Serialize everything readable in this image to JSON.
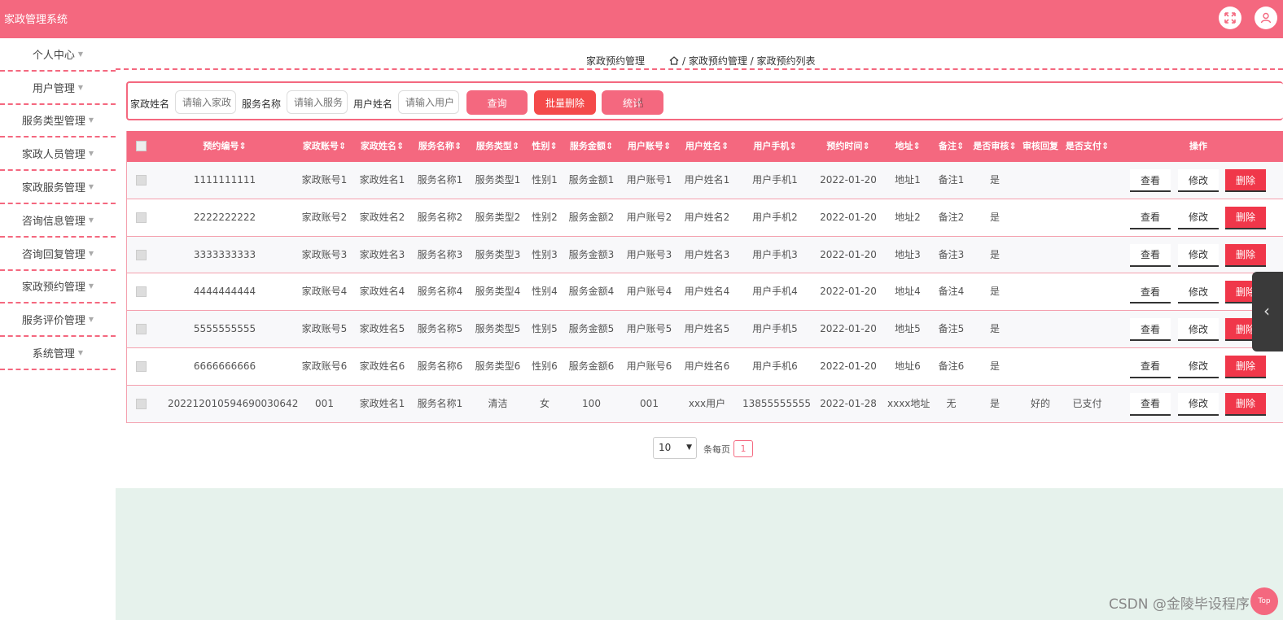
{
  "app": {
    "title": "家政管理系统"
  },
  "header": {
    "fullscreen_icon": "expand-icon",
    "user_icon": "user-icon"
  },
  "sidebar": {
    "items": [
      {
        "label": "个人中心"
      },
      {
        "label": "用户管理"
      },
      {
        "label": "服务类型管理"
      },
      {
        "label": "家政人员管理"
      },
      {
        "label": "家政服务管理"
      },
      {
        "label": "咨询信息管理"
      },
      {
        "label": "咨询回复管理"
      },
      {
        "label": "家政预约管理"
      },
      {
        "label": "服务评价管理"
      },
      {
        "label": "系统管理"
      }
    ]
  },
  "breadcrumb": {
    "title": "家政预约管理",
    "path": "/ 家政预约管理 / 家政预约列表"
  },
  "search": {
    "label_1": "家政姓名",
    "placeholder_1": "请输入家政",
    "label_2": "服务名称",
    "placeholder_2": "请输入服务",
    "label_3": "用户姓名",
    "placeholder_3": "请输入用户",
    "query_label": "查询",
    "batch_delete_label": "批量删除",
    "stats_label": "统计"
  },
  "colors": {
    "primary": "#f4687f",
    "danger": "#f0374a",
    "batch": "#f44a4a",
    "footer_bg": "#e6f2ec"
  },
  "table": {
    "headers": [
      "预约编号",
      "家政账号",
      "家政姓名",
      "服务名称",
      "服务类型",
      "性别",
      "服务金额",
      "用户账号",
      "用户姓名",
      "用户手机",
      "预约时间",
      "地址",
      "备注",
      "是否审核",
      "审核回复",
      "是否支付",
      "操作"
    ],
    "rows": [
      [
        "1111111111",
        "家政账号1",
        "家政姓名1",
        "服务名称1",
        "服务类型1",
        "性别1",
        "服务金额1",
        "用户账号1",
        "用户姓名1",
        "用户手机1",
        "2022-01-20",
        "地址1",
        "备注1",
        "是",
        "",
        ""
      ],
      [
        "2222222222",
        "家政账号2",
        "家政姓名2",
        "服务名称2",
        "服务类型2",
        "性别2",
        "服务金额2",
        "用户账号2",
        "用户姓名2",
        "用户手机2",
        "2022-01-20",
        "地址2",
        "备注2",
        "是",
        "",
        ""
      ],
      [
        "3333333333",
        "家政账号3",
        "家政姓名3",
        "服务名称3",
        "服务类型3",
        "性别3",
        "服务金额3",
        "用户账号3",
        "用户姓名3",
        "用户手机3",
        "2022-01-20",
        "地址3",
        "备注3",
        "是",
        "",
        ""
      ],
      [
        "4444444444",
        "家政账号4",
        "家政姓名4",
        "服务名称4",
        "服务类型4",
        "性别4",
        "服务金额4",
        "用户账号4",
        "用户姓名4",
        "用户手机4",
        "2022-01-20",
        "地址4",
        "备注4",
        "是",
        "",
        ""
      ],
      [
        "5555555555",
        "家政账号5",
        "家政姓名5",
        "服务名称5",
        "服务类型5",
        "性别5",
        "服务金额5",
        "用户账号5",
        "用户姓名5",
        "用户手机5",
        "2022-01-20",
        "地址5",
        "备注5",
        "是",
        "",
        ""
      ],
      [
        "6666666666",
        "家政账号6",
        "家政姓名6",
        "服务名称6",
        "服务类型6",
        "性别6",
        "服务金额6",
        "用户账号6",
        "用户姓名6",
        "用户手机6",
        "2022-01-20",
        "地址6",
        "备注6",
        "是",
        "",
        ""
      ],
      [
        "20221201059469003 0642",
        "001",
        "家政姓名1",
        "服务名称1",
        "清洁",
        "女",
        "100",
        "001",
        "xxx用户",
        "13855555555",
        "2022-01-28",
        "xxxx地址",
        "无",
        "是",
        "好的",
        "已支付"
      ]
    ],
    "actions": {
      "view": "查看",
      "edit": "修改",
      "delete": "删除"
    }
  },
  "pagination": {
    "page_size": "10",
    "per_page_label": "条每页",
    "current_page": "1"
  },
  "footer": {
    "watermark": "CSDN @金陵毕设程序",
    "top_label": "Top"
  }
}
